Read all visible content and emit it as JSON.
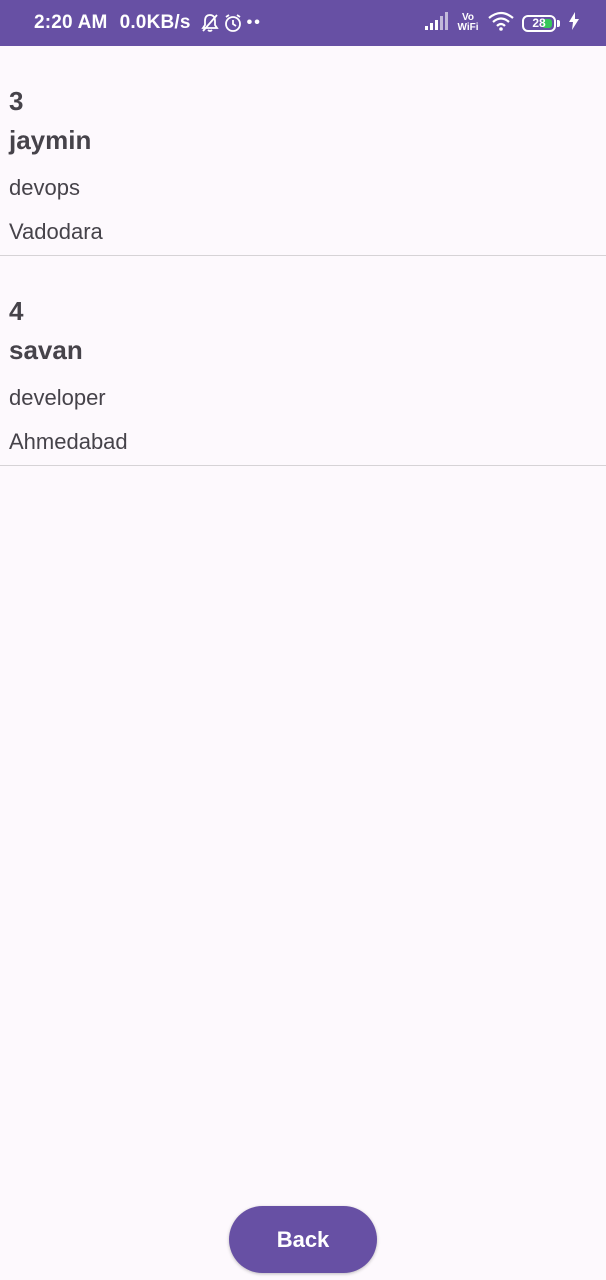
{
  "status_bar": {
    "time": "2:20 AM",
    "speed": "0.0KB/s",
    "icons_left": [
      "bell-off-icon",
      "alarm-icon"
    ],
    "vowifi_top": "Vo",
    "vowifi_bottom": "WiFi",
    "battery": "28",
    "icons_right": [
      "signal-icon",
      "wifi-icon",
      "charging-icon"
    ],
    "bar_color": "#6750a4",
    "battery_fill_color": "#35c759"
  },
  "records": [
    {
      "id": "3",
      "name": "jaymin",
      "role": "devops",
      "city": "Vadodara"
    },
    {
      "id": "4",
      "name": "savan",
      "role": "developer",
      "city": "Ahmedabad"
    }
  ],
  "back_button": {
    "label": "Back",
    "color": "#6750a4"
  }
}
